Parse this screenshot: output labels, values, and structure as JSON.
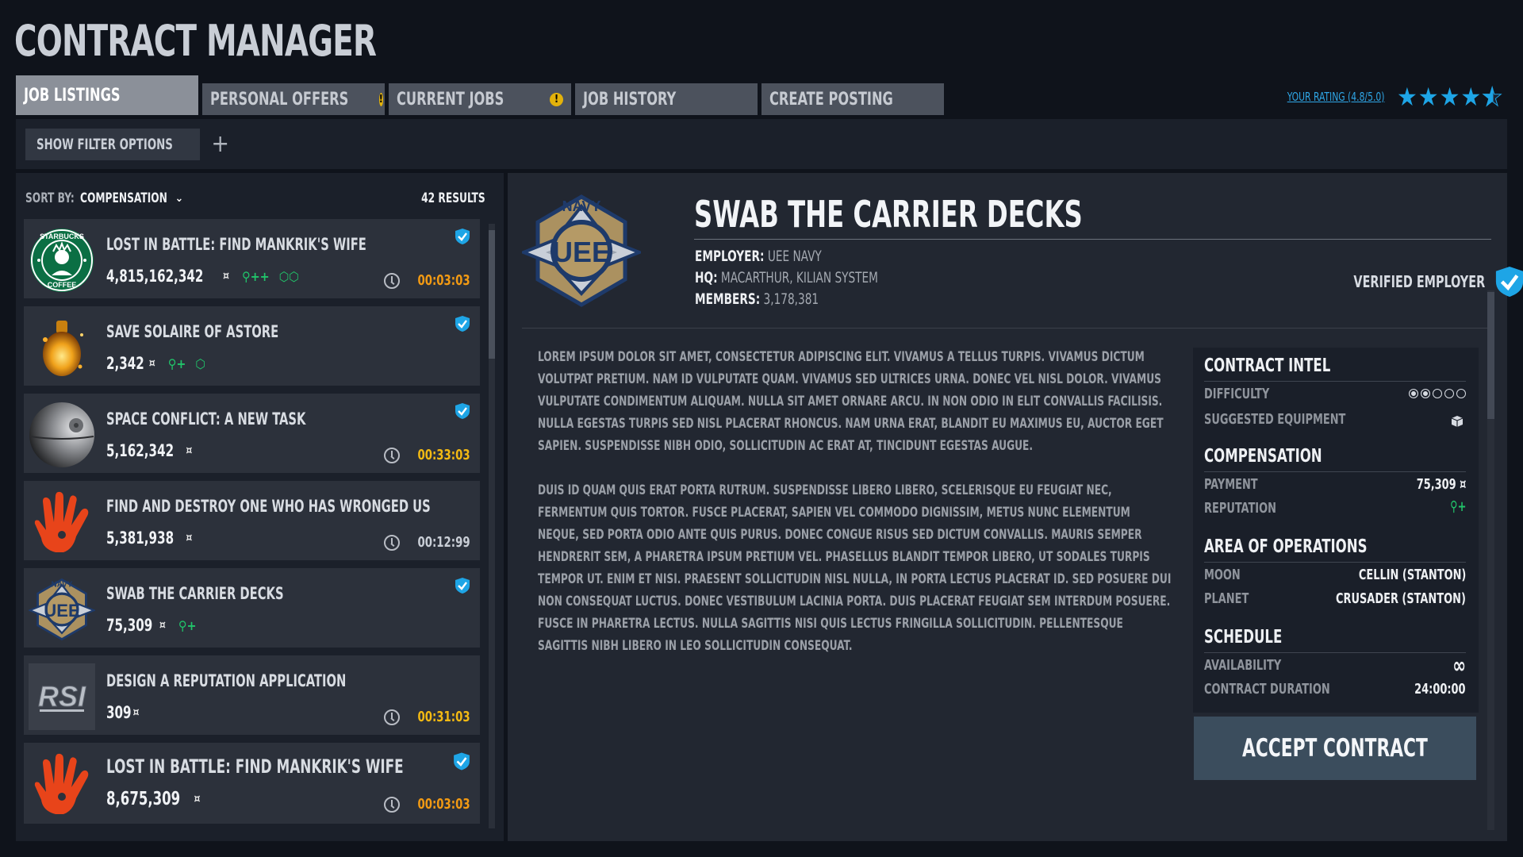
{
  "app": {
    "title": "CONTRACT MANAGER"
  },
  "tabs": [
    {
      "label": "JOB LISTINGS",
      "active": true,
      "alert": false
    },
    {
      "label": "PERSONAL OFFERS",
      "active": false,
      "alert": true
    },
    {
      "label": "CURRENT JOBS",
      "active": false,
      "alert": true
    },
    {
      "label": "JOB HISTORY",
      "active": false,
      "alert": false
    },
    {
      "label": "CREATE POSTING",
      "active": false,
      "alert": false
    }
  ],
  "rating": {
    "link_text": "YOUR RATING (4.8/5.0)",
    "value": 4.8,
    "max": 5,
    "accent": "#1ea5e6"
  },
  "filter": {
    "label": "SHOW FILTER OPTIONS",
    "icon": "plus-icon"
  },
  "sort": {
    "label": "SORT BY:",
    "value": "COMPENSATION",
    "icon": "chevron-down-icon"
  },
  "results": "42 RESULTS",
  "listings": [
    {
      "title": "LOST IN BATTLE: FIND MANKRIK'S WIFE",
      "pay": "4,815,162,342",
      "currency": "¤",
      "thumb": "starbucks-logo",
      "verified": true,
      "rep": "++",
      "cargo": 2,
      "timer": "00:03:03",
      "timer_color": "#f29a13"
    },
    {
      "title": "SAVE SOLAIRE OF ASTORE",
      "pay": "2,342",
      "currency": "¤",
      "thumb": "golden-flask-image",
      "verified": true,
      "rep": "+",
      "cargo": 1,
      "timer": "",
      "timer_color": ""
    },
    {
      "title": "SPACE CONFLICT: A NEW TASK",
      "pay": "5,162,342",
      "currency": "¤",
      "thumb": "death-star-image",
      "verified": true,
      "rep": "",
      "cargo": 0,
      "timer": "00:33:03",
      "timer_color": "#f2b913"
    },
    {
      "title": "FIND AND DESTROY ONE WHO HAS WRONGED US",
      "pay": "5,381,938",
      "currency": "¤",
      "thumb": "red-hand-logo",
      "verified": false,
      "rep": "",
      "cargo": 0,
      "timer": "00:12:99",
      "timer_color": "#c9ced6"
    },
    {
      "title": "SWAB THE CARRIER DECKS",
      "pay": "75,309",
      "currency": "¤",
      "thumb": "uee-navy-logo",
      "verified": true,
      "rep": "+",
      "cargo": 0,
      "timer": "",
      "timer_color": ""
    },
    {
      "title": "DESIGN A REPUTATION APPLICATION",
      "pay": "309",
      "currency": "¤",
      "thumb": "rsi-logo",
      "verified": false,
      "rep": "",
      "cargo": 0,
      "timer": "00:31:03",
      "timer_color": "#f2b913"
    },
    {
      "title": "LOST IN BATTLE: FIND MANKRIK'S WIFE",
      "pay": "8,675,309",
      "currency": "¤",
      "thumb": "red-hand-logo",
      "verified": true,
      "rep": "",
      "cargo": 0,
      "timer": "00:03:03",
      "timer_color": "#f29a13"
    }
  ],
  "detail": {
    "title": "SWAB THE CARRIER DECKS",
    "employer_label": "EMPLOYER:",
    "employer": "UEE NAVY",
    "hq_label": "HQ:",
    "hq": "MACARTHUR, KILIAN SYSTEM",
    "members_label": "MEMBERS:",
    "members": "3,178,381",
    "verified_label": "VERIFIED EMPLOYER",
    "paragraphs": [
      "LOREM IPSUM DOLOR SIT AMET, CONSECTETUR ADIPISCING ELIT. VIVAMUS A TELLUS TURPIS. VIVAMUS DICTUM VOLUTPAT PRETIUM. NAM ID VULPUTATE QUAM. VIVAMUS SED ULTRICES URNA. DONEC VEL NISL DOLOR. VIVAMUS VULPUTATE CONDIMENTUM ALIQUAM. NULLA SIT AMET ORNARE ARCU. IN NON ODIO IN ELIT CONVALLIS FACILISIS. NULLA EGESTAS TURPIS SED NISL PLACERAT RHONCUS. NAM URNA ERAT, BLANDIT EU MAXIMUS EU, AUCTOR EGET SAPIEN. SUSPENDISSE NIBH ODIO, SOLLICITUDIN AC ERAT AT, TINCIDUNT EGESTAS AUGUE.",
      "DUIS ID QUAM QUIS ERAT PORTA RUTRUM. SUSPENDISSE LIBERO LIBERO, SCELERISQUE EU FEUGIAT NEC, FERMENTUM QUIS TORTOR. FUSCE PLACERAT, SAPIEN VEL COMMODO DIGNISSIM, METUS NUNC ELEMENTUM NEQUE, SED PORTA ODIO ANTE QUIS PURUS. DONEC CONGUE RISUS SED DICTUM CONVALLIS. MAURIS SEMPER HENDRERIT SEM, A PHARETRA IPSUM PRETIUM VEL. PHASELLUS BLANDIT TEMPOR LIBERO, UT SODALES TURPIS TEMPOR UT. ENIM ET NISI. PRAESENT SOLLICITUDIN NISL NULLA, IN PORTA LECTUS PLACERAT ID. SED POSUERE DUI NON CONSEQUAT LUCTUS. DONEC VESTIBULUM LACINIA PORTA. DUIS PLACERAT FEUGIAT SEM INTERDUM POSUERE. FUSCE IN PHARETRA LECTUS. NULLA SAGITTIS NISI QUIS LECTUS FRINGILLA SOLLICITUDIN. PELLENTESQUE SAGITTIS NIBH LIBERO IN LEO SOLLICITUDIN CONSEQUAT."
    ]
  },
  "intel": {
    "contract_intel": "CONTRACT INTEL",
    "difficulty_label": "DIFFICULTY",
    "difficulty_level": 2,
    "difficulty_max": 5,
    "equipment_label": "SUGGESTED EQUIPMENT",
    "equipment_icon": "cube-icon",
    "compensation": "COMPENSATION",
    "payment_label": "PAYMENT",
    "payment": "75,309 ¤",
    "reputation_label": "REPUTATION",
    "reputation": "+",
    "area": "AREA OF OPERATIONS",
    "moon_label": "MOON",
    "moon": "CELLIN (STANTON)",
    "planet_label": "PLANET",
    "planet": "CRUSADER (STANTON)",
    "schedule": "SCHEDULE",
    "availability_label": "AVAILABILITY",
    "availability": "∞",
    "duration_label": "CONTRACT DURATION",
    "duration": "24:00:00"
  },
  "accept_label": "ACCEPT CONTRACT"
}
